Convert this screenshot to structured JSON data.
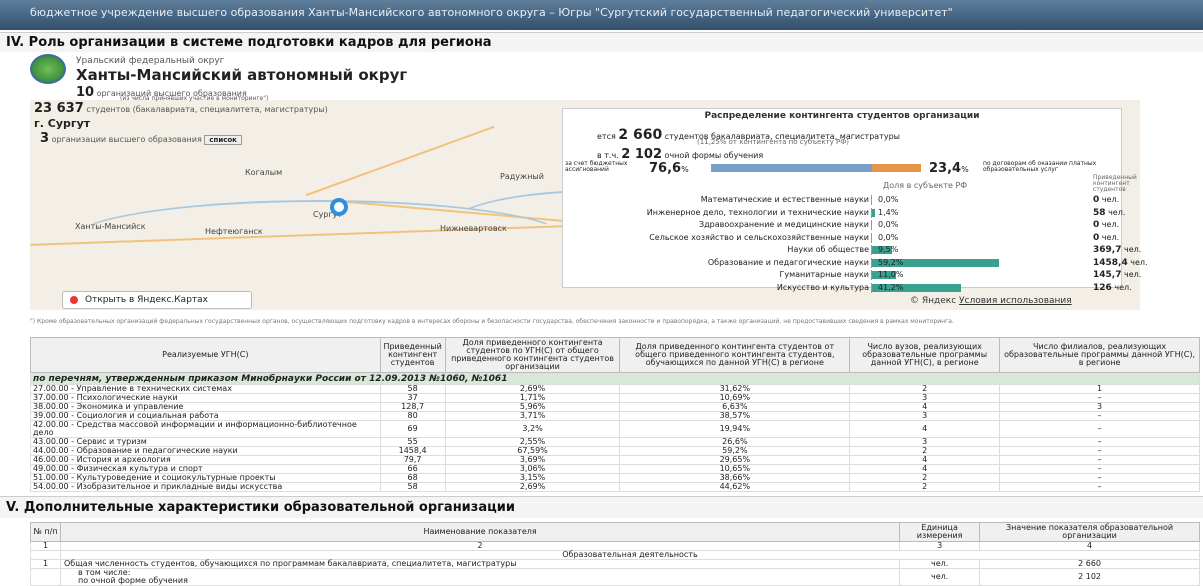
{
  "topbar": {
    "text": "бюджетное учреждение высшего образования Ханты-Мансийского автономного округа – Югры \"Сургутский государственный педагогический университет\""
  },
  "section4": {
    "title": "IV. Роль организации в системе подготовки кадров для региона"
  },
  "region": {
    "district": "Уральский федеральный округ",
    "name": "Ханты-Мансийский автономный округ",
    "orgs_count": "10",
    "orgs_label": "организаций высшего образования",
    "orgs_note": "(из числа принявших участие в мониторинге\")",
    "students_count": "23 637",
    "students_label": "студентов (бакалавриата, специалитета, магистратуры)",
    "city": "г. Сургут",
    "city_orgs_count": "3",
    "city_orgs_label": "организации высшего образования",
    "list_button": "список"
  },
  "map": {
    "cities": [
      "Когалым",
      "Радужный",
      "Ханты-Мансийск",
      "Нефтеюганск",
      "Сургут",
      "Нижневартовск"
    ],
    "open_label": "Открыть в Яндекс.Картах",
    "legal": "© Яндекс",
    "terms": "Условия использования"
  },
  "dist": {
    "title": "Распределение контингента студентов организации",
    "total_prefix": "ется",
    "total": "2 660",
    "total_label": "студентов бакалавриата, специалитета, магистратуры",
    "total_note": "(11,25% от контингента по субъекту РФ)",
    "ft_prefix": "в т.ч.",
    "ft": "2 102",
    "ft_label": "очной формы обучения",
    "budget_label": "за счет бюджетных ассигнований",
    "budget_pct": "76,6",
    "contract_pct": "23,4",
    "contract_label": "по договорам об оказании платных образовательных услуг",
    "pct_sign": "%",
    "col_share": "Доля в субъекте РФ",
    "col_count": "Приведенный контингент студентов",
    "rows": [
      {
        "label": "Математические и естественные науки",
        "pct": "0,0%",
        "count": "0",
        "unit": "чел.",
        "frac": 0
      },
      {
        "label": "Инженерное дело, технологии и технические науки",
        "pct": "1,4%",
        "count": "58",
        "unit": "чел.",
        "frac": 0.014
      },
      {
        "label": "Здравоохранение и медицинские науки",
        "pct": "0,0%",
        "count": "0",
        "unit": "чел.",
        "frac": 0
      },
      {
        "label": "Сельское хозяйство и сельскохозяйственные науки",
        "pct": "0,0%",
        "count": "0",
        "unit": "чел.",
        "frac": 0
      },
      {
        "label": "Науки об обществе",
        "pct": "9,5%",
        "count": "369,7",
        "unit": "чел.",
        "frac": 0.095
      },
      {
        "label": "Образование и педагогические науки",
        "pct": "59,2%",
        "count": "1458,4",
        "unit": "чел.",
        "frac": 0.592
      },
      {
        "label": "Гуманитарные науки",
        "pct": "11,0%",
        "count": "145,7",
        "unit": "чел.",
        "frac": 0.11
      },
      {
        "label": "Искусство и культура",
        "pct": "41,2%",
        "count": "126",
        "unit": "чел.",
        "frac": 0.412
      }
    ]
  },
  "footnote": "\") Кроме образовательных организаций федеральных государственных органов, осуществляющих подготовку кадров в интересах обороны и безопасности государства, обеспечения законности и правопорядка, а также организаций, не предоставивших сведения в рамках мониторинга.",
  "t1": {
    "headers": [
      "Реализуемые УГН(С)",
      "Приведенный контингент студентов",
      "Доля приведенного контингента студентов по УГН(С) от общего приведенного контингента студентов организации",
      "Доля приведенного контингента студентов от общего приведенного контингента студентов, обучающихся по данной УГН(С) в регионе",
      "Число вузов, реализующих образовательные программы данной УГН(С), в регионе",
      "Число филиалов, реализующих образовательные программы данной УГН(С), в регионе"
    ],
    "group": "по перечням, утвержденным приказом Минобрнауки России от 12.09.2013 №1060, №1061",
    "rows": [
      [
        "27.00.00 - Управление в технических системах",
        "58",
        "2,69%",
        "31,62%",
        "2",
        "1"
      ],
      [
        "37.00.00 - Психологические науки",
        "37",
        "1,71%",
        "10,69%",
        "3",
        "–"
      ],
      [
        "38.00.00 - Экономика и управление",
        "128,7",
        "5,96%",
        "6,63%",
        "4",
        "3"
      ],
      [
        "39.00.00 - Социология и социальная работа",
        "80",
        "3,71%",
        "38,57%",
        "3",
        "–"
      ],
      [
        "42.00.00 - Средства массовой информации и информационно-библиотечное дело",
        "69",
        "3,2%",
        "19,94%",
        "4",
        "–"
      ],
      [
        "43.00.00 - Сервис и туризм",
        "55",
        "2,55%",
        "26,6%",
        "3",
        "–"
      ],
      [
        "44.00.00 - Образование и педагогические науки",
        "1458,4",
        "67,59%",
        "59,2%",
        "2",
        "–"
      ],
      [
        "46.00.00 - История и археология",
        "79,7",
        "3,69%",
        "29,65%",
        "4",
        "–"
      ],
      [
        "49.00.00 - Физическая культура и спорт",
        "66",
        "3,06%",
        "10,65%",
        "4",
        "–"
      ],
      [
        "51.00.00 - Культуроведение и социокультурные проекты",
        "68",
        "3,15%",
        "38,66%",
        "2",
        "–"
      ],
      [
        "54.00.00 - Изобразительное и прикладные виды искусства",
        "58",
        "2,69%",
        "44,62%",
        "2",
        "–"
      ]
    ]
  },
  "section5": {
    "title": "V. Дополнительные характеристики образовательной организации"
  },
  "t2": {
    "h_num": "№ п/п",
    "h_name": "Наименование показателя",
    "h_unit": "Единица измерения",
    "h_value": "Значение показателя образовательной организации",
    "n1": "1",
    "n2": "2",
    "n3": "3",
    "n4": "4",
    "group": "Образовательная деятельность",
    "r1": {
      "num": "1",
      "name": "Общая численность студентов, обучающихся по программам бакалавриата, специалитета, магистратуры",
      "unit": "чел.",
      "value": "2 660"
    },
    "r2": {
      "name_a": "в том числе:",
      "name_b": "по очной форме обучения",
      "unit": "чел.",
      "value": "2 102"
    }
  }
}
